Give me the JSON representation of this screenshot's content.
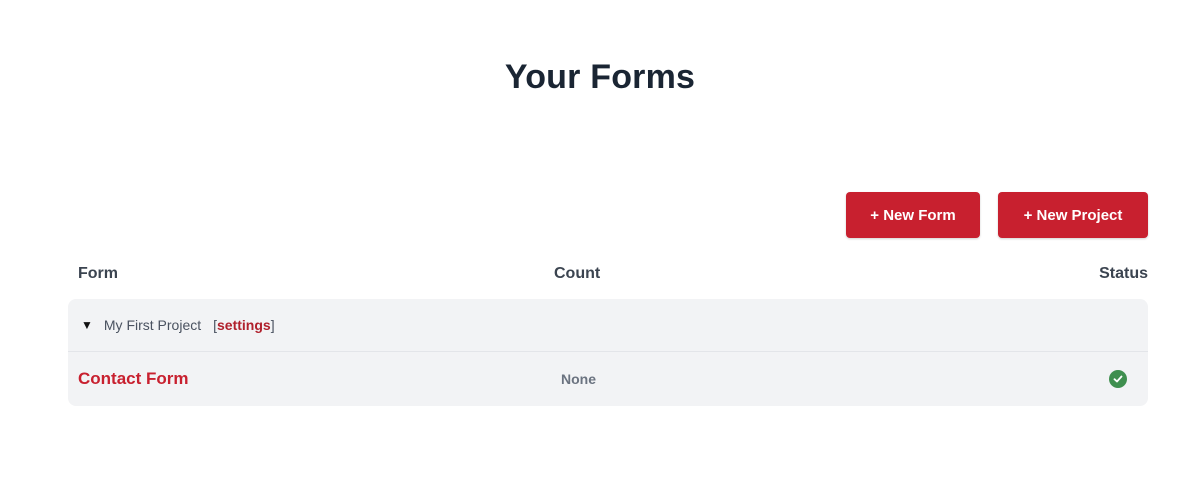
{
  "page": {
    "title": "Your Forms"
  },
  "actions": {
    "new_form_label": "+ New Form",
    "new_project_label": "+ New Project"
  },
  "table": {
    "headers": {
      "form": "Form",
      "count": "Count",
      "status": "Status"
    },
    "projects": [
      {
        "name": "My First Project",
        "settings_label": "settings",
        "expanded": true,
        "forms": [
          {
            "name": "Contact Form",
            "count": "None",
            "status": "active"
          }
        ]
      }
    ]
  },
  "colors": {
    "accent": "#c8202f",
    "status_ok": "#3f8f4f",
    "row_bg": "#f2f3f5"
  },
  "icons": {
    "caret": "caret-down-icon",
    "status": "check-circle-icon"
  }
}
